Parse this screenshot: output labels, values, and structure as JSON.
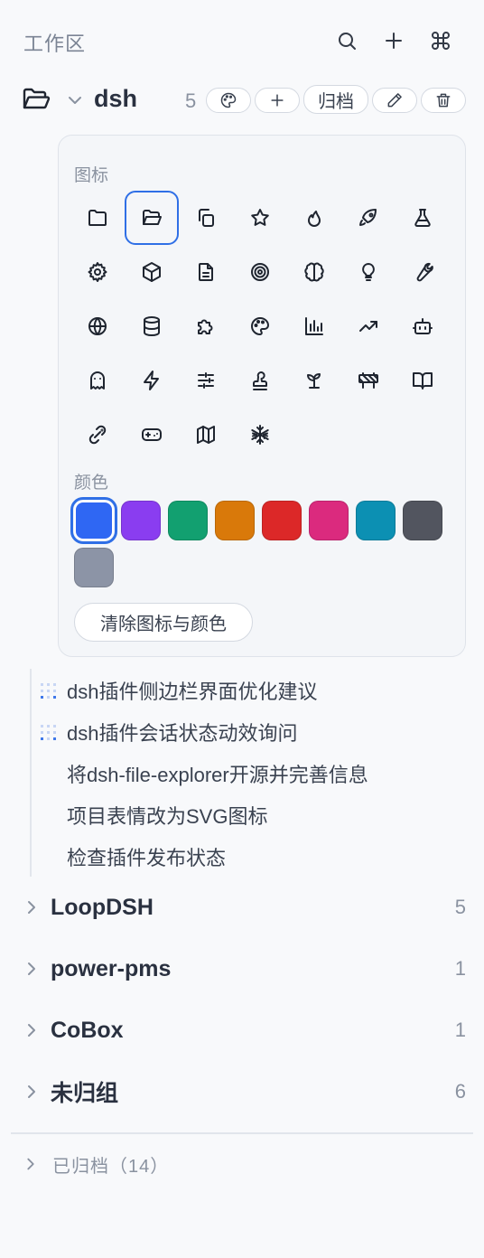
{
  "header": {
    "title": "工作区",
    "actions": [
      "search-icon",
      "plus-icon",
      "command-icon"
    ]
  },
  "project": {
    "icon": "folder-open-icon",
    "name": "dsh",
    "count": "5",
    "actions": {
      "palette": "palette-icon",
      "add": "plus-icon",
      "archive_label": "归档",
      "edit": "pencil-icon",
      "delete": "trash-icon"
    }
  },
  "picker": {
    "icon_label": "图标",
    "color_label": "颜色",
    "icons": [
      "folder",
      "folder-open",
      "copy",
      "star",
      "flame",
      "rocket",
      "flask",
      "gear",
      "box",
      "document",
      "target",
      "brain",
      "lightbulb",
      "wrench",
      "globe",
      "database",
      "puzzle",
      "palette",
      "bar-chart",
      "trending-up",
      "bot",
      "ghost",
      "zap",
      "sliders",
      "stamp",
      "sprout",
      "construction",
      "book-open",
      "link",
      "gamepad",
      "map",
      "snowflake"
    ],
    "selected_icon": "folder-open",
    "colors": [
      "#2f67f3",
      "#8a3df0",
      "#12a070",
      "#d9790a",
      "#dc2828",
      "#db2a7e",
      "#0c90b3",
      "#52555f",
      "#8c94a6"
    ],
    "selected_color": "#2f67f3",
    "clear_label": "清除图标与颜色"
  },
  "sessions": [
    {
      "title": "dsh插件侧边栏界面优化建议",
      "active": true
    },
    {
      "title": "dsh插件会话状态动效询问",
      "active": true
    },
    {
      "title": "将dsh-file-explorer开源并完善信息",
      "active": false
    },
    {
      "title": "项目表情改为SVG图标",
      "active": false
    },
    {
      "title": "检查插件发布状态",
      "active": false
    }
  ],
  "groups": [
    {
      "name": "LoopDSH",
      "count": "5"
    },
    {
      "name": "power-pms",
      "count": "1"
    },
    {
      "name": "CoBox",
      "count": "1"
    },
    {
      "name": "未归组",
      "count": "6"
    }
  ],
  "archived": {
    "label": "已归档（14）"
  },
  "colors": {
    "accent": "#2f6fe6",
    "text_primary": "#2a3140",
    "text_muted": "#8a92a0",
    "background": "#f8f9fb"
  }
}
